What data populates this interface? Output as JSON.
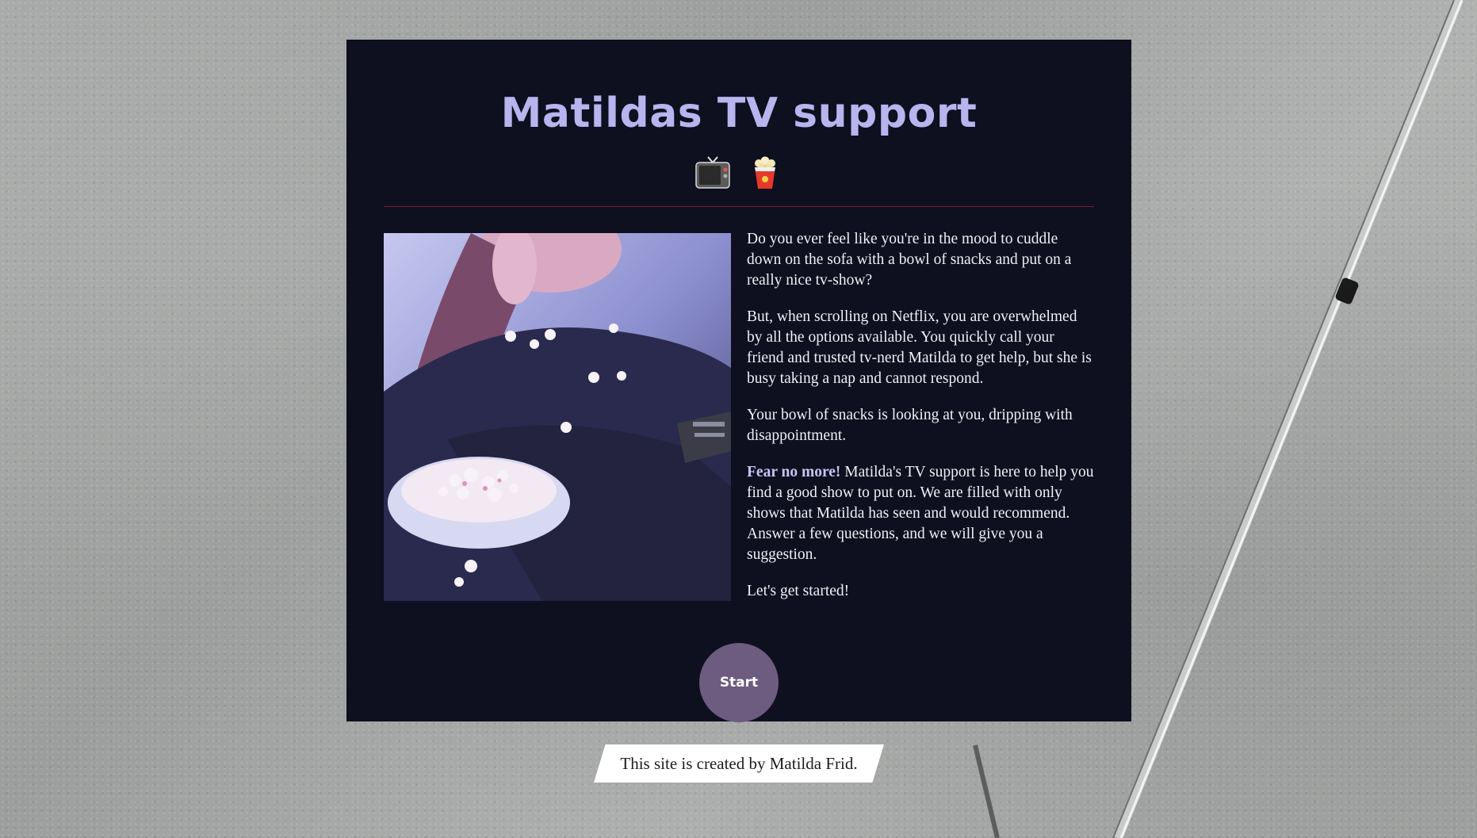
{
  "header": {
    "title": "Matildas TV support",
    "icons": [
      "tv-icon",
      "popcorn-icon"
    ]
  },
  "intro": {
    "paragraph_1": "Do you ever feel like you're in the mood to cuddle down on the sofa with a bowl of snacks and put on a really nice tv-show?",
    "paragraph_2": "But, when scrolling on Netflix, you are overwhelmed by all the options available. You quickly call your friend and trusted tv-nerd Matilda to get help, but she is busy taking a nap and cannot respond.",
    "paragraph_3": "Your bowl of snacks is looking at you, dripping with disappointment.",
    "paragraph_4_highlight": "Fear no more!",
    "paragraph_4_rest": " Matilda's TV support is here to help you find a good show to put on. We are filled with only shows that Matilda has seen and would recommend. Answer a few questions, and we will give you a suggestion.",
    "paragraph_5": "Let's get started!"
  },
  "actions": {
    "start_label": "Start"
  },
  "footer": {
    "text": "This site is created by Matilda Frid."
  },
  "colors": {
    "card_background": "#0e0f1f",
    "title": "#b8b4ee",
    "divider": "#7a1f2a",
    "start_button": "#6d5b80",
    "highlight": "#c9c2f5"
  }
}
